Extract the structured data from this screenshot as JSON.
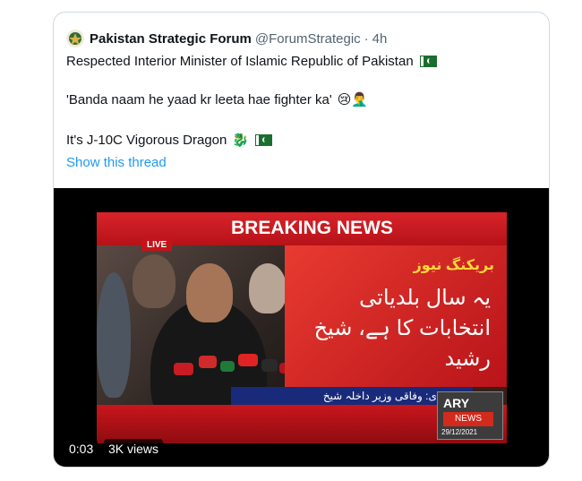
{
  "tweet": {
    "author_name": "Pakistan Strategic Forum",
    "handle": "@ForumStrategic",
    "separator": "·",
    "time": "4h",
    "line1": "Respected Interior Minister of Islamic Republic of Pakistan",
    "line2": "'Banda naam he yaad kr leeta hae fighter ka'",
    "line2_emojis": "😢🤦‍♂️",
    "line3": "It's J-10C Vigorous Dragon",
    "line3_emoji": "🐉",
    "show_thread": "Show this thread"
  },
  "video": {
    "headline": "BREAKING NEWS",
    "live_label": "LIVE",
    "urdu_kicker": "بریکنگ نیوز",
    "urdu_headline": "یہ سال بلدیاتی انتخابات کا ہے، شیخ رشید",
    "urdu_ticker": "راولپنڈی: وفاقی وزیر داخلہ شیخ",
    "channel": "ARY",
    "channel_sub": "NEWS",
    "date": "29/12/2021",
    "duration": "0:03",
    "views": "3K views"
  },
  "colors": {
    "link": "#1d9bf0",
    "secondary_text": "#536471",
    "border": "#cfd9de"
  }
}
